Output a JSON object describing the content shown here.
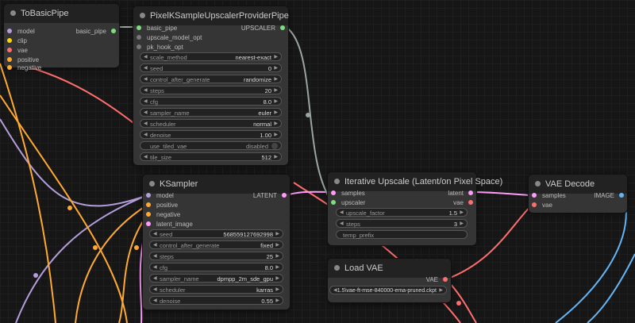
{
  "colors": {
    "model": "#b39ddb",
    "clip": "#ffd500",
    "vae": "#ff6e6e",
    "conditioning": "#ffa931",
    "latent": "#ff9cf9",
    "image": "#64b5f6",
    "basic_pipe": "#7be07b"
  },
  "to_basic_pipe": {
    "title": "ToBasicPipe",
    "inputs": [
      "model",
      "clip",
      "vae",
      "positive",
      "negative"
    ],
    "output": "basic_pipe"
  },
  "upscaler_provider": {
    "title": "PixelKSampleUpscalerProviderPipe",
    "inputs": [
      "basic_pipe",
      "upscale_model_opt",
      "pk_hook_opt"
    ],
    "output": "UPSCALER",
    "widgets": [
      {
        "label": "scale_method",
        "value": "nearest-exact"
      },
      {
        "label": "seed",
        "value": "0"
      },
      {
        "label": "control_after_generate",
        "value": "randomize"
      },
      {
        "label": "steps",
        "value": "20"
      },
      {
        "label": "cfg",
        "value": "8.0"
      },
      {
        "label": "sampler_name",
        "value": "euler"
      },
      {
        "label": "scheduler",
        "value": "normal"
      },
      {
        "label": "denoise",
        "value": "1.00"
      },
      {
        "label": "use_tiled_vae",
        "value": "disabled"
      },
      {
        "label": "tile_size",
        "value": "512"
      }
    ]
  },
  "ksampler": {
    "title": "KSampler",
    "inputs": [
      "model",
      "positive",
      "negative",
      "latent_image"
    ],
    "output": "LATENT",
    "widgets": [
      {
        "label": "seed",
        "value": "568559127692998"
      },
      {
        "label": "control_after_generate",
        "value": "fixed"
      },
      {
        "label": "steps",
        "value": "25"
      },
      {
        "label": "cfg",
        "value": "8.0"
      },
      {
        "label": "sampler_name",
        "value": "dpmpp_2m_sde_gpu"
      },
      {
        "label": "scheduler",
        "value": "karras"
      },
      {
        "label": "denoise",
        "value": "0.55"
      }
    ]
  },
  "iterative_upscale": {
    "title": "Iterative Upscale (Latent/on Pixel Space)",
    "inputs": [
      "samples",
      "upscaler"
    ],
    "outputs": [
      "latent",
      "vae"
    ],
    "widgets": [
      {
        "label": "upscale_factor",
        "value": "1.5"
      },
      {
        "label": "steps",
        "value": "3"
      },
      {
        "label": "temp_prefix",
        "value": ""
      }
    ]
  },
  "vae_decode": {
    "title": "VAE Decode",
    "inputs": [
      "samples",
      "vae"
    ],
    "output": "IMAGE"
  },
  "load_vae": {
    "title": "Load VAE",
    "output": "VAE",
    "vae_name": "1.5\\vae-ft-mse-840000-ema-pruned.ckpt"
  }
}
